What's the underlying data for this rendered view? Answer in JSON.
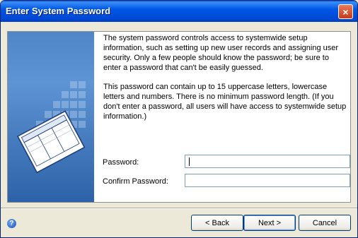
{
  "window": {
    "title": "Enter System Password",
    "close_glyph": "×"
  },
  "description": {
    "para1": "The system password controls access to systemwide setup information, such as setting up new user records and assigning user security. Only a few people should know the password; be sure to enter a password that can't be easily guessed.",
    "para2": "This password can contain up to 15 uppercase letters, lowercase letters and numbers. There is no minimum password length. (If you don't enter a password, all users will have access to systemwide setup information.)"
  },
  "form": {
    "password_label": "Password:",
    "password_value": "",
    "confirm_label": "Confirm Password:",
    "confirm_value": ""
  },
  "buttons": {
    "back": "< Back",
    "next": "Next >",
    "cancel": "Cancel"
  },
  "icons": {
    "help": "help-icon",
    "close": "close-icon"
  }
}
